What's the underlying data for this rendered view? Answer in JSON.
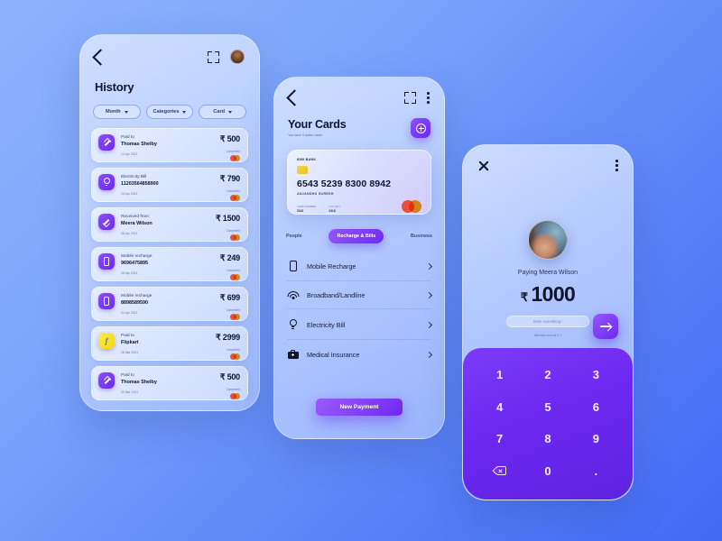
{
  "background": {
    "from": "#8db2fc",
    "to": "#4169f5"
  },
  "accent": {
    "purple": "#6d28f0",
    "purple_light": "#9556fc",
    "yellow": "#f5d90a"
  },
  "history_screen": {
    "title": "History",
    "header": {
      "back_icon": "chevron-left-icon",
      "scan_icon": "scan-frame-icon",
      "avatar": "user-avatar"
    },
    "filters": [
      {
        "label": "Month"
      },
      {
        "label": "Categories"
      },
      {
        "label": "Card"
      }
    ],
    "transactions": [
      {
        "label": "Paid to",
        "name": "Thomas Shelby",
        "amount": "₹ 500",
        "date": "12 Apr 2021",
        "status": "Completed",
        "icon": "arrow-up-right-icon"
      },
      {
        "label": "Electricity Bill",
        "name": "11203564858900",
        "amount": "₹ 790",
        "date": "10 Apr 2021",
        "status": "Completed",
        "icon": "bulb-icon"
      },
      {
        "label": "Received from",
        "name": "Meera Wilson",
        "amount": "₹ 1500",
        "date": "08 Apr 2021",
        "status": "Completed",
        "icon": "arrow-down-left-icon"
      },
      {
        "label": "Mobile recharge",
        "name": "9696475895",
        "amount": "₹ 249",
        "date": "05 Apr 2021",
        "status": "Completed",
        "icon": "mobile-icon"
      },
      {
        "label": "Mobile recharge",
        "name": "8898589590",
        "amount": "₹ 699",
        "date": "02 Apr 2021",
        "status": "Completed",
        "icon": "mobile-icon"
      },
      {
        "label": "Paid to",
        "name": "Flipkart",
        "amount": "₹ 2999",
        "date": "28 Mar 2021",
        "status": "Completed",
        "icon": "flipkart-icon"
      },
      {
        "label": "Paid to",
        "name": "Thomas Shelby",
        "amount": "₹ 500",
        "date": "25 Mar 2021",
        "status": "Completed",
        "icon": "arrow-up-right-icon"
      }
    ]
  },
  "cards_screen": {
    "title": "Your Cards",
    "subtitle": "You have 3 active cards",
    "add_button_icon": "plus-circle-icon",
    "header": {
      "back_icon": "chevron-left-icon",
      "scan_icon": "scan-frame-icon",
      "menu_icon": "kebab-menu-icon"
    },
    "card": {
      "bank": "IDBI BANK",
      "number": "6543 5239 8300 8942",
      "holder": "ANJANDHU SURESH",
      "fields": [
        {
          "label": "CARD NUMBER",
          "value": "0318"
        },
        {
          "label": "CVV KEY",
          "value": "0318"
        }
      ],
      "network": "mastercard"
    },
    "tabs": [
      {
        "label": "People",
        "active": false
      },
      {
        "label": "Recharge & Bills",
        "active": true
      },
      {
        "label": "Business",
        "active": false
      }
    ],
    "services": [
      {
        "label": "Mobile Recharge",
        "icon": "mobile-icon"
      },
      {
        "label": "Broadband/Landline",
        "icon": "wifi-icon"
      },
      {
        "label": "Electricity Bill",
        "icon": "bulb-icon"
      },
      {
        "label": "Medical Insurance",
        "icon": "medical-bag-icon"
      }
    ],
    "cta": "New Payment"
  },
  "pay_screen": {
    "header": {
      "close_icon": "close-icon",
      "menu_icon": "kebab-menu-icon"
    },
    "avatar": "recipient-avatar",
    "paying_to": "Paying Meera Wilson",
    "currency": "₹",
    "amount": "1000",
    "note_placeholder": "Write something !",
    "minimum_note": "Minimum amount  ₹ 1",
    "next_icon": "arrow-right-icon",
    "keypad": [
      {
        "label": "1",
        "type": "digit"
      },
      {
        "label": "2",
        "type": "digit"
      },
      {
        "label": "3",
        "type": "digit"
      },
      {
        "label": "4",
        "type": "digit"
      },
      {
        "label": "5",
        "type": "digit"
      },
      {
        "label": "6",
        "type": "digit"
      },
      {
        "label": "7",
        "type": "digit"
      },
      {
        "label": "8",
        "type": "digit"
      },
      {
        "label": "9",
        "type": "digit"
      },
      {
        "label": "",
        "type": "backspace"
      },
      {
        "label": "0",
        "type": "digit"
      },
      {
        "label": ".",
        "type": "digit"
      }
    ]
  }
}
